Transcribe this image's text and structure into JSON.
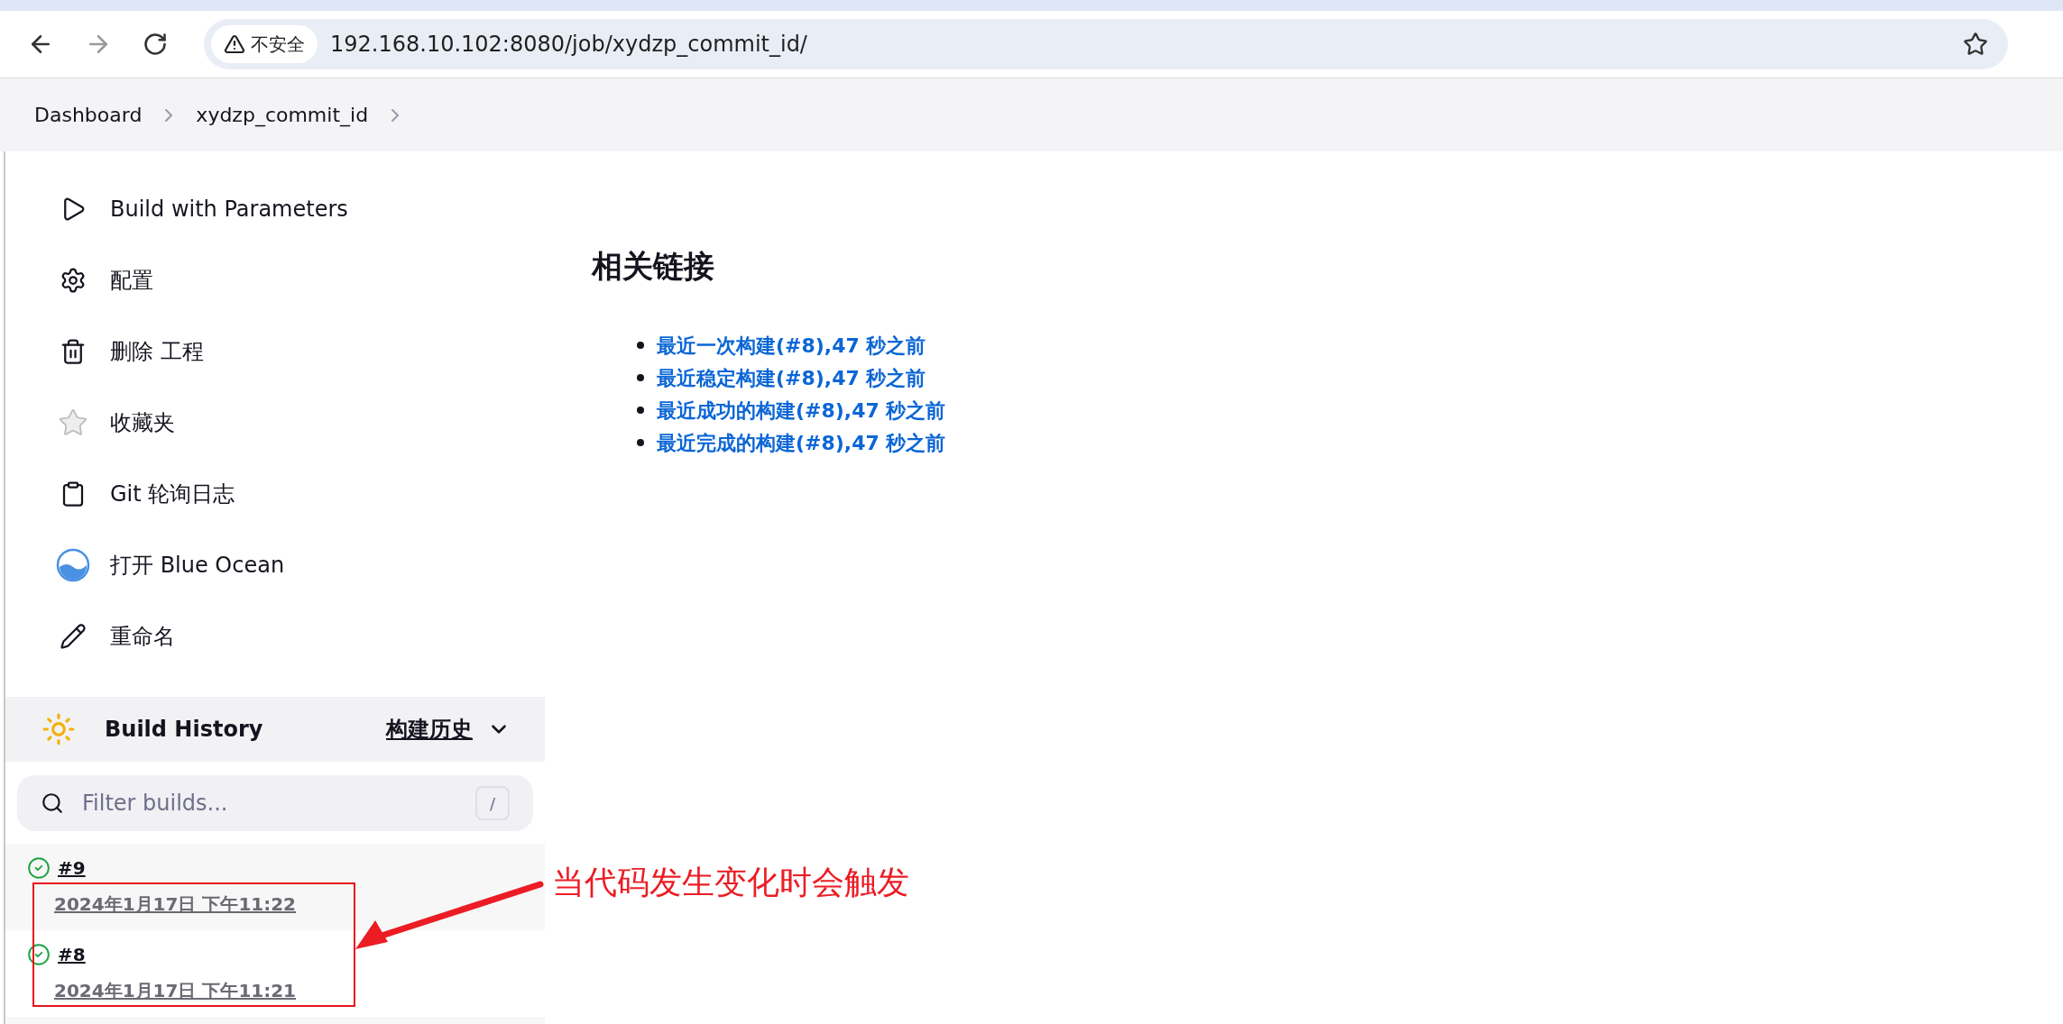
{
  "browser": {
    "security_label": "不安全",
    "url": "192.168.10.102:8080/job/xydzp_commit_id/"
  },
  "breadcrumbs": [
    "Dashboard",
    "xydzp_commit_id"
  ],
  "sidebar": {
    "items": [
      {
        "label": "Build with Parameters"
      },
      {
        "label": "配置"
      },
      {
        "label": "删除 工程"
      },
      {
        "label": "收藏夹"
      },
      {
        "label": "Git 轮询日志"
      },
      {
        "label": "打开 Blue Ocean"
      },
      {
        "label": "重命名"
      }
    ]
  },
  "build_history": {
    "title": "Build History",
    "link": "构建历史",
    "filter_placeholder": "Filter builds...",
    "shortcut": "/",
    "builds": [
      {
        "number": "#9",
        "date": "2024年1月17日 下午11:22"
      },
      {
        "number": "#8",
        "date": "2024年1月17日 下午11:21"
      }
    ]
  },
  "main": {
    "heading": "相关链接",
    "links": [
      "最近一次构建(#8),47 秒之前",
      "最近稳定构建(#8),47 秒之前",
      "最近成功的构建(#8),47 秒之前",
      "最近完成的构建(#8),47 秒之前"
    ]
  },
  "annotation": {
    "text": "当代码发生变化时会触发"
  }
}
